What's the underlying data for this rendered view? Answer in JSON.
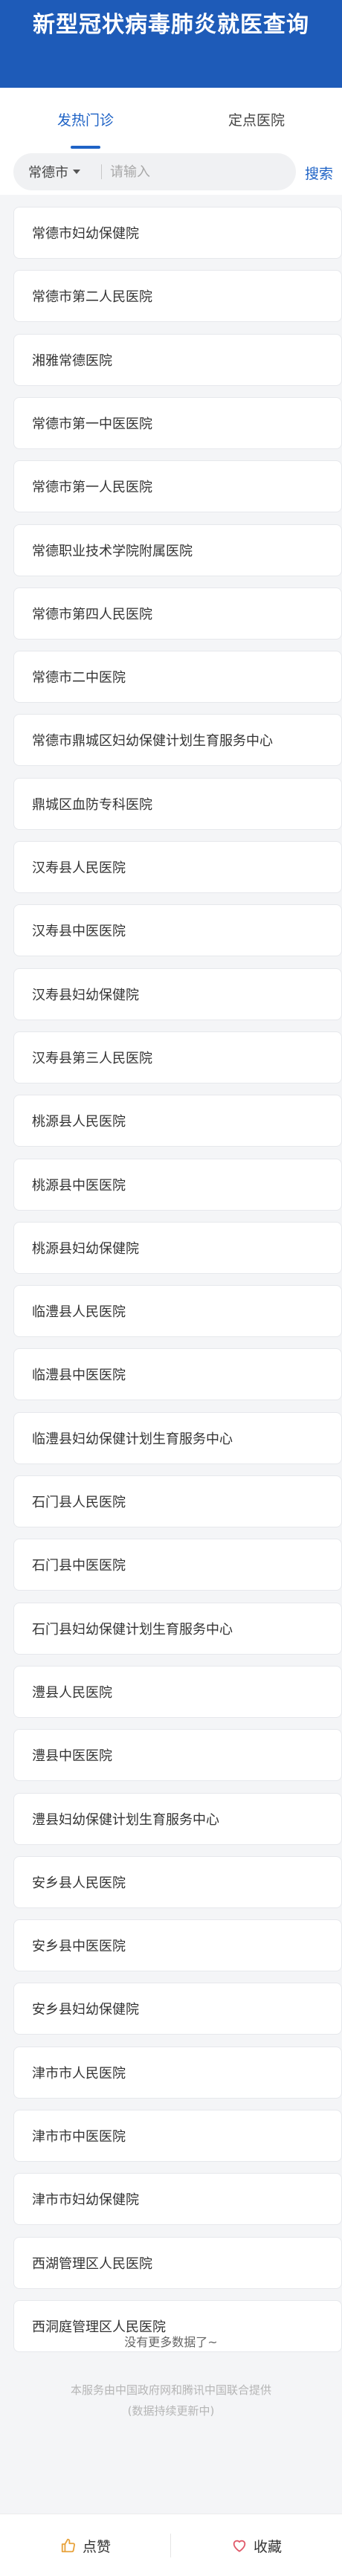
{
  "header": {
    "title": "新型冠状病毒肺炎就医查询"
  },
  "tabs": [
    {
      "label": "发热门诊",
      "active": true
    },
    {
      "label": "定点医院",
      "active": false
    }
  ],
  "search": {
    "city": "常德市",
    "placeholder": "请输入",
    "button_label": "搜索"
  },
  "hospitals": [
    "常德市妇幼保健院",
    "常德市第二人民医院",
    "湘雅常德医院",
    "常德市第一中医医院",
    "常德市第一人民医院",
    "常德职业技术学院附属医院",
    "常德市第四人民医院",
    "常德市二中医院",
    "常德市鼎城区妇幼保健计划生育服务中心",
    "鼎城区血防专科医院",
    "汉寿县人民医院",
    "汉寿县中医医院",
    "汉寿县妇幼保健院",
    "汉寿县第三人民医院",
    "桃源县人民医院",
    "桃源县中医医院",
    "桃源县妇幼保健院",
    "临澧县人民医院",
    "临澧县中医医院",
    "临澧县妇幼保健计划生育服务中心",
    "石门县人民医院",
    "石门县中医医院",
    "石门县妇幼保健计划生育服务中心",
    "澧县人民医院",
    "澧县中医医院",
    "澧县妇幼保健计划生育服务中心",
    "安乡县人民医院",
    "安乡县中医医院",
    "安乡县妇幼保健院",
    "津市市人民医院",
    "津市市中医医院",
    "津市市妇幼保健院",
    "西湖管理区人民医院",
    "西洞庭管理区人民医院"
  ],
  "list_end_text": "没有更多数据了~",
  "footnote": {
    "line1": "本服务由中国政府网和腾讯中国联合提供",
    "line2": "(数据持续更新中)"
  },
  "bottom_bar": {
    "like_label": "点赞",
    "favorite_label": "收藏",
    "like_icon": "thumbs-up-icon",
    "favorite_icon": "heart-icon"
  },
  "colors": {
    "header_bg": "#1e5bb8",
    "accent": "#1f63c6",
    "like_icon": "#e8a33d",
    "favorite_icon": "#e05a6a"
  }
}
